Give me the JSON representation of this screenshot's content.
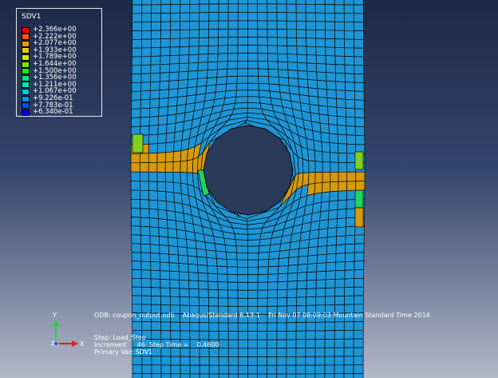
{
  "legend": {
    "title": "SDV1",
    "entries": [
      {
        "label": "+2.366e+00",
        "color": "#ff0000"
      },
      {
        "label": "+2.222e+00",
        "color": "#ff5a00"
      },
      {
        "label": "+2.077e+00",
        "color": "#e8a000"
      },
      {
        "label": "+1.933e+00",
        "color": "#e6ce00"
      },
      {
        "label": "+1.789e+00",
        "color": "#d4e600"
      },
      {
        "label": "+1.644e+00",
        "color": "#7ee600"
      },
      {
        "label": "+1.500e+00",
        "color": "#1ee61e"
      },
      {
        "label": "+1.356e+00",
        "color": "#00e67e"
      },
      {
        "label": "+1.211e+00",
        "color": "#00e6c8"
      },
      {
        "label": "+1.067e+00",
        "color": "#00c8e6"
      },
      {
        "label": "+9.226e-01",
        "color": "#0096e6"
      },
      {
        "label": "+7.783e-01",
        "color": "#0050e6"
      },
      {
        "label": "+6.340e-01",
        "color": "#0000e6"
      }
    ]
  },
  "colors": {
    "mesh_base": "#1e96d6",
    "hot": "#d69a0a",
    "green_light": "#7ed21c",
    "green_mid": "#1fd45a",
    "hole": "#2a3a5a",
    "edge": "#0a0a0a"
  },
  "info": {
    "odb": "ODB: coupon_output.odb    Abaqus/Standard 6.13-1    Fri Nov 07 08:09:03 Mountain Standard Time 2014",
    "step": "Step: Load_Step",
    "increment": "Increment     46: Step Time =    0.4600",
    "primary_var": "Primary Var: SDV1"
  },
  "triad": {
    "y_label": "Y",
    "z_label": "Z",
    "x_label": "X"
  }
}
